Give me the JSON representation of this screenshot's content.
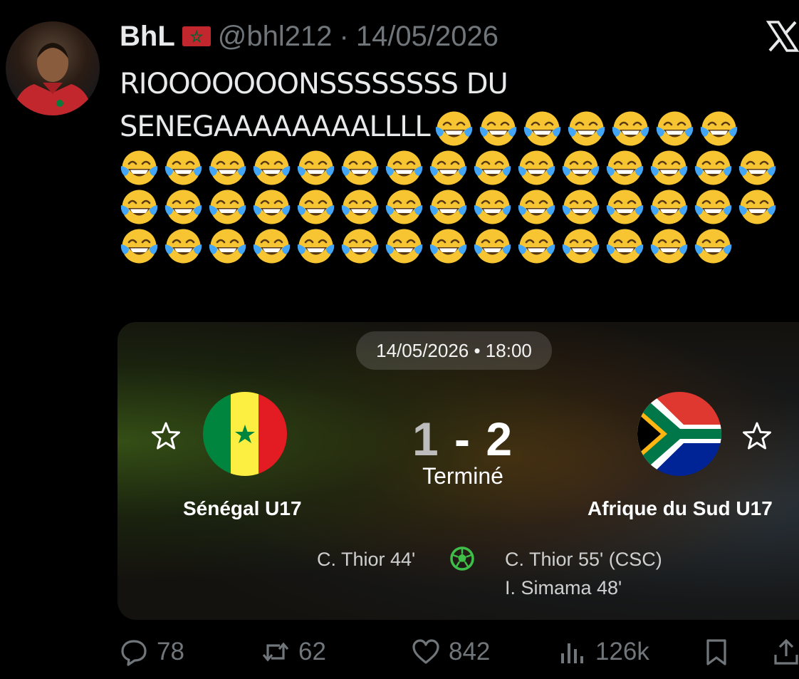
{
  "tweet": {
    "author_name": "BhL",
    "author_flag": "morocco-flag",
    "handle": "@bhl212",
    "separator": "·",
    "date": "14/05/2026",
    "text_line1": "RIOOOOOOONSSSSSSSS DU",
    "text_line2": "SENEGAAAAAAAALLLL",
    "emoji": "face-with-tears-of-joy",
    "emoji_count": 51
  },
  "match": {
    "datetime": "14/05/2026 • 18:00",
    "home_team": "Sénégal U17",
    "away_team": "Afrique du Sud U17",
    "home_score": "1",
    "score_separator": "-",
    "away_score": "2",
    "status": "Terminé",
    "home_scorers": [
      "C. Thior 44'"
    ],
    "away_scorers": [
      "C. Thior 55' (CSC)",
      "I. Simama 48'"
    ],
    "colors": {
      "senegal": [
        "#00853f",
        "#fdef42",
        "#e31b23"
      ],
      "south_africa": [
        "#007749",
        "#de3831",
        "#002395",
        "#ffb612",
        "#000000",
        "#ffffff"
      ]
    }
  },
  "actions": {
    "replies": "78",
    "reposts": "62",
    "likes": "842",
    "views": "126k"
  }
}
